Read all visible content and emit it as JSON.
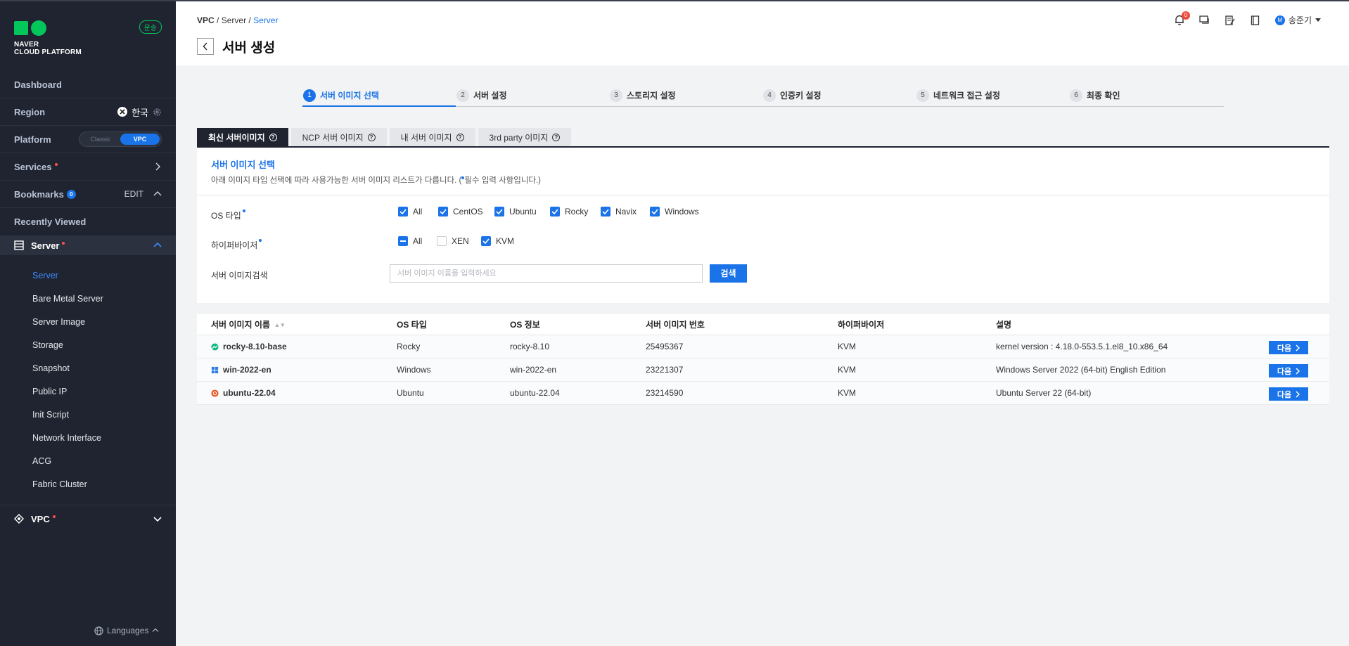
{
  "sidebar": {
    "logo_line1": "NAVER",
    "logo_line2": "CLOUD PLATFORM",
    "env_badge": "운송",
    "dashboard": "Dashboard",
    "region_label": "Region",
    "region_value": "한국",
    "platform_label": "Platform",
    "platform_classic": "Classic",
    "platform_vpc": "VPC",
    "services": "Services",
    "bookmarks": "Bookmarks",
    "bookmarks_count": "0",
    "bookmarks_edit": "EDIT",
    "recently_viewed": "Recently Viewed",
    "server_group": "Server",
    "server_items": [
      "Server",
      "Bare Metal Server",
      "Server Image",
      "Storage",
      "Snapshot",
      "Public IP",
      "Init Script",
      "Network Interface",
      "ACG",
      "Fabric Cluster"
    ],
    "vpc_group": "VPC",
    "languages": "Languages"
  },
  "header": {
    "breadcrumb": [
      "VPC",
      "Server",
      "Server"
    ],
    "sep": "/",
    "title": "서버 생성",
    "notif_count": "0",
    "user_initial": "M",
    "user_name": "송준기"
  },
  "steps": [
    {
      "num": "1",
      "label": "서버 이미지 선택"
    },
    {
      "num": "2",
      "label": "서버 설정"
    },
    {
      "num": "3",
      "label": "스토리지 설정"
    },
    {
      "num": "4",
      "label": "인증키 설정"
    },
    {
      "num": "5",
      "label": "네트워크 접근 설정"
    },
    {
      "num": "6",
      "label": "최종 확인"
    }
  ],
  "tabs": [
    "최신 서버이미지",
    "NCP 서버 이미지",
    "내 서버 이미지",
    "3rd party 이미지"
  ],
  "panel": {
    "title": "서버 이미지 선택",
    "desc_prefix": "아래 이미지 타입 선택에 따라 사용가능한 서버 이미지 리스트가 다릅니다. (",
    "desc_suffix": "필수 입력 사항입니다.)",
    "os_label": "OS 타입",
    "os_options": [
      "All",
      "CentOS",
      "Ubuntu",
      "Rocky",
      "Navix",
      "Windows"
    ],
    "hv_label": "하이퍼바이저",
    "hv_options": [
      "All",
      "XEN",
      "KVM"
    ],
    "search_label": "서버 이미지검색",
    "search_placeholder": "서버 이미지 이름을 입력하세요",
    "search_button": "검색"
  },
  "table": {
    "headers": [
      "서버 이미지 이름",
      "OS 타입",
      "OS 정보",
      "서버 이미지 번호",
      "하이퍼바이저",
      "설명"
    ],
    "rows": [
      {
        "name": "rocky-8.10-base",
        "os_type": "Rocky",
        "os_info": "rocky-8.10",
        "number": "25495367",
        "hypervisor": "KVM",
        "desc": "kernel version : 4.18.0-553.5.1.el8_10.x86_64",
        "action": "다음"
      },
      {
        "name": "win-2022-en",
        "os_type": "Windows",
        "os_info": "win-2022-en",
        "number": "23221307",
        "hypervisor": "KVM",
        "desc": "Windows Server 2022 (64-bit) English Edition",
        "action": "다음"
      },
      {
        "name": "ubuntu-22.04",
        "os_type": "Ubuntu",
        "os_info": "ubuntu-22.04",
        "number": "23214590",
        "hypervisor": "KVM",
        "desc": "Ubuntu Server 22 (64-bit)",
        "action": "다음"
      }
    ]
  },
  "colors": {
    "accent": "#1a73e8",
    "sidebar_bg": "#1f2430",
    "brand_green": "#03c75a",
    "alert_red": "#f04c3b"
  }
}
